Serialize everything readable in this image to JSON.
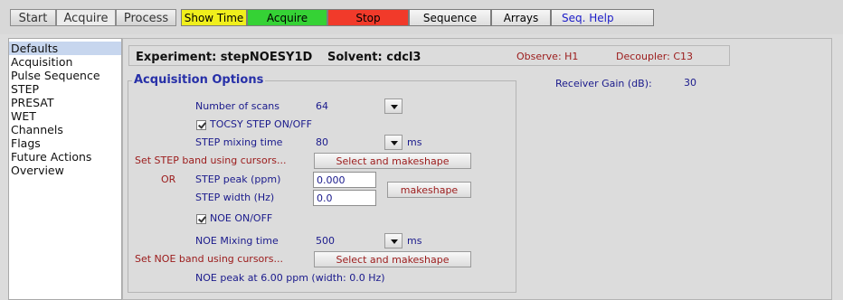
{
  "tabs": [
    "Start",
    "Acquire",
    "Process"
  ],
  "active_tab": "Acquire",
  "toolbar": {
    "show_time": "Show Time",
    "acquire": "Acquire",
    "stop": "Stop",
    "sequence": "Sequence",
    "arrays": "Arrays",
    "seq_help": "Seq. Help"
  },
  "colors": {
    "show_time": "#f0ef1c",
    "acquire": "#35d235",
    "stop": "#f13a2a",
    "label_blue": "#1a1a8c",
    "label_red": "#9b1a1a",
    "selected": "#c7d6ee"
  },
  "sidebar": {
    "items": [
      "Defaults",
      "Acquisition",
      "Pulse Sequence",
      "STEP",
      "PRESAT",
      "WET",
      "Channels",
      "Flags",
      "Future Actions",
      "Overview"
    ],
    "selected": "Defaults"
  },
  "header": {
    "experiment": "Experiment: stepNOESY1D",
    "solvent": "Solvent: cdcl3",
    "observe": "Observe: H1",
    "decoupler": "Decoupler: C13"
  },
  "receiver_gain": {
    "label": "Receiver Gain (dB):",
    "value": "30"
  },
  "acq": {
    "title": "Acquisition Options",
    "scans_label": "Number of scans",
    "scans_value": "64",
    "tocsy_label": "TOCSY STEP  ON/OFF",
    "step_mix_label": "STEP mixing time",
    "step_mix_value": "80",
    "step_mix_unit": "ms",
    "set_step_label": "Set STEP band using cursors...",
    "select_make_1": "Select and makeshape",
    "or_label": "OR",
    "step_peak_label": "STEP peak (ppm)",
    "step_peak_value": "0.000",
    "step_width_label": "STEP width (Hz)",
    "step_width_value": "0.0",
    "makeshape": "makeshape",
    "noe_label": "NOE  ON/OFF",
    "noe_mix_label": "NOE Mixing time",
    "noe_mix_value": "500",
    "noe_mix_unit": "ms",
    "set_noe_label": "Set NOE band using cursors...",
    "select_make_2": "Select and makeshape",
    "noe_peak_text": "NOE peak at 6.00 ppm (width: 0.0 Hz)"
  }
}
